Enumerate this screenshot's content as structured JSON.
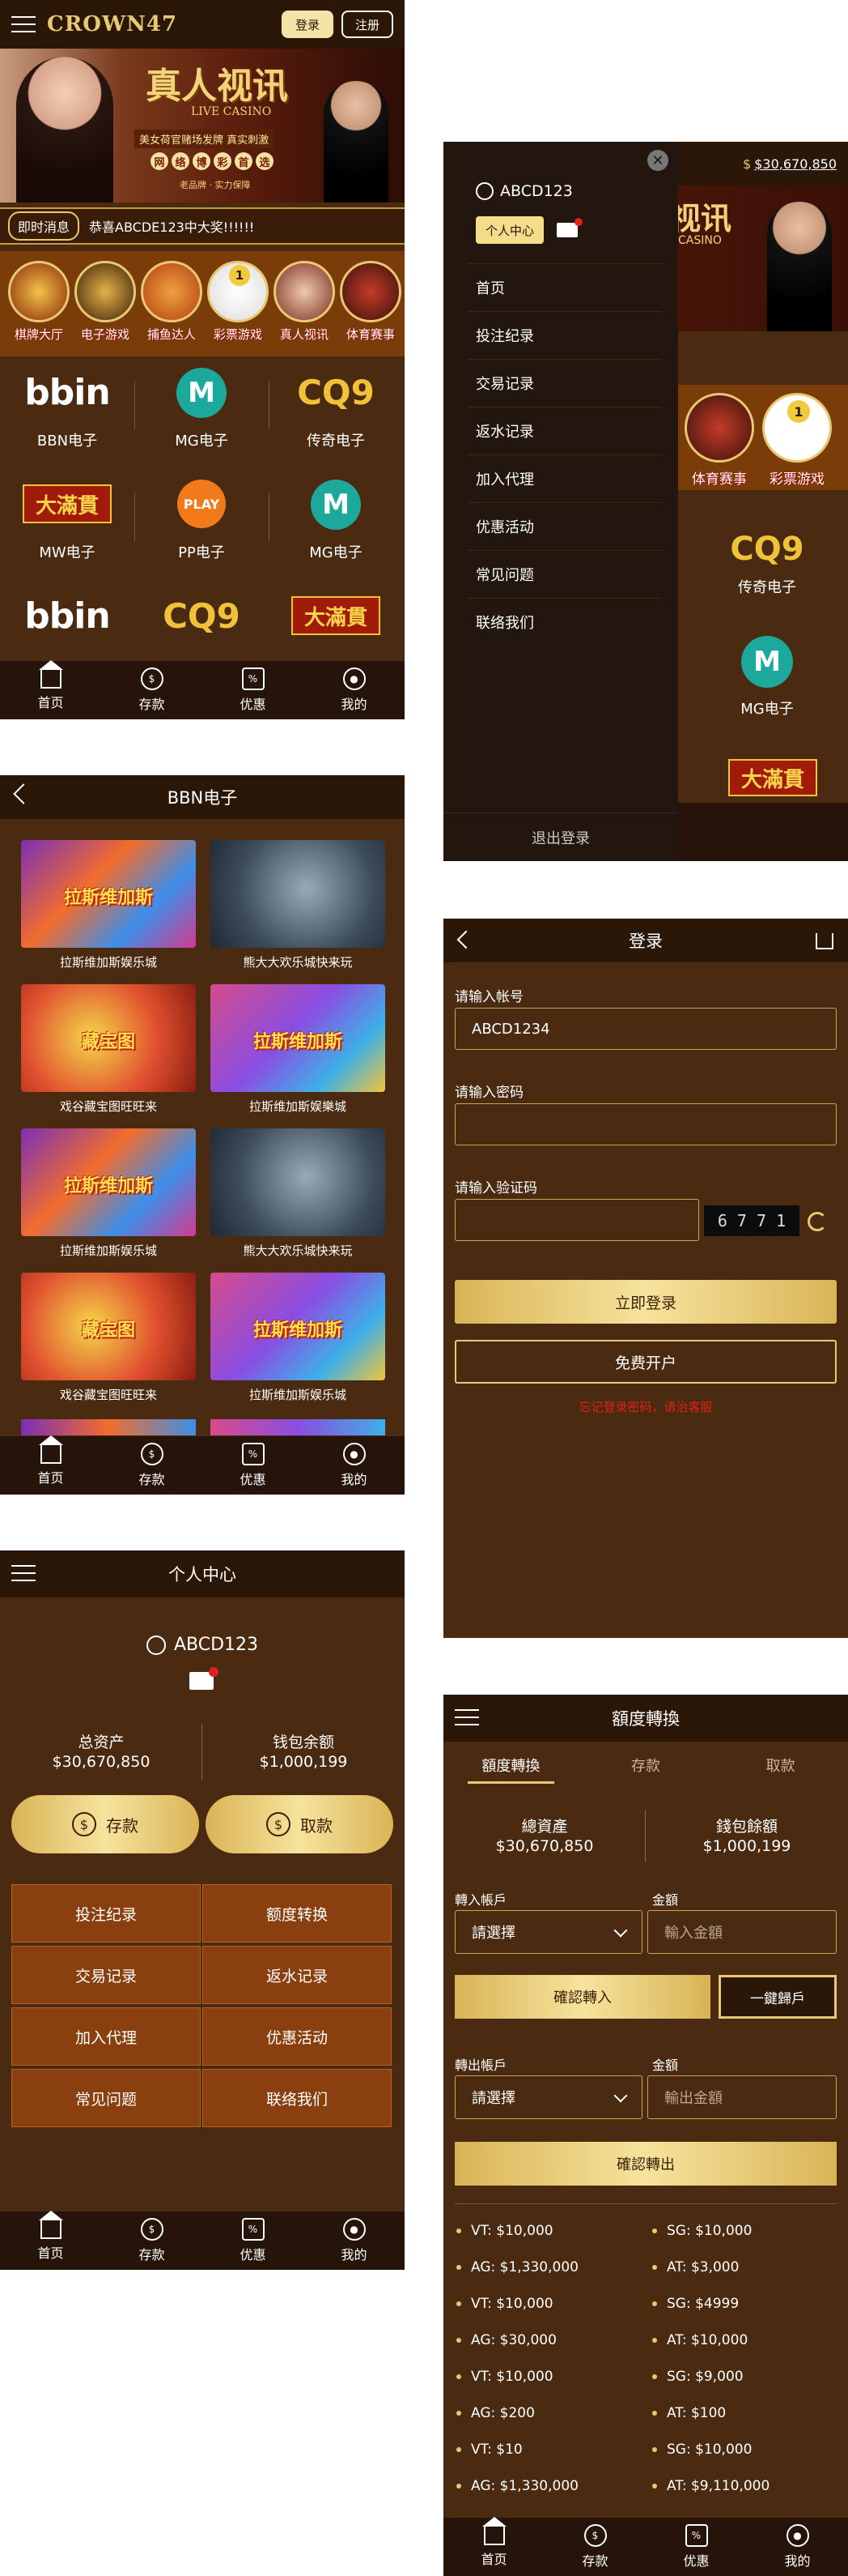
{
  "s1": {
    "logo": "CROWN47",
    "login": "登录",
    "register": "注册",
    "banner": {
      "title": "真人视讯",
      "sub": "LIVE CASINO",
      "line1": "美女荷官赌场发牌 真实刺激",
      "chips": [
        "网",
        "络",
        "博",
        "彩",
        "首",
        "选"
      ],
      "slogan": "老品牌 · 实力保障"
    },
    "marquee_label": "即时消息",
    "marquee_text": "恭喜ABCDE123中大奖!!!!!!",
    "cats": [
      "棋牌大厅",
      "电子游戏",
      "捕鱼达人",
      "彩票游戏",
      "真人视讯",
      "体育赛事"
    ],
    "lottery_badge": "1",
    "games": [
      {
        "logo": "bbin",
        "label": "BBN电子"
      },
      {
        "logo": "M",
        "label": "MG电子"
      },
      {
        "logo": "CQ9",
        "label": "传奇电子"
      },
      {
        "logo": "大滿貫",
        "label": "MW电子"
      },
      {
        "logo": "PLAY",
        "label": "PP电子"
      },
      {
        "logo": "M",
        "label": "MG电子"
      },
      {
        "logo": "bbin",
        "label": ""
      },
      {
        "logo": "CQ9",
        "label": ""
      },
      {
        "logo": "大滿貫",
        "label": ""
      }
    ]
  },
  "tabs": [
    "首页",
    "存款",
    "优惠",
    "我的"
  ],
  "s2": {
    "balance": "$30,670,850",
    "user": "ABCD123",
    "center_btn": "个人中心",
    "menu": [
      "首页",
      "投注纪录",
      "交易记录",
      "返水记录",
      "加入代理",
      "优惠活动",
      "常见问题",
      "联络我们"
    ],
    "logout": "退出登录",
    "bg_banner": "视讯",
    "bg_banner_sub": "CASINO",
    "bg_cats": [
      "体育赛事",
      "彩票游戏"
    ],
    "bg_lottery_badge": "1",
    "bg_games": [
      {
        "logo": "CQ9",
        "label": "传奇电子"
      },
      {
        "logo": "M",
        "label": "MG电子"
      },
      {
        "logo": "大滿貫",
        "label": ""
      }
    ]
  },
  "s3": {
    "title": "BBN电子",
    "items": [
      {
        "cap": "拉斯维加斯娱乐城",
        "img": "t1",
        "text": "拉斯维加斯"
      },
      {
        "cap": "熊大大欢乐城快来玩",
        "img": "t2",
        "text": ""
      },
      {
        "cap": "戏谷藏宝图旺旺来",
        "img": "t3",
        "text": "藏宝图"
      },
      {
        "cap": "拉斯维加斯娱樂城",
        "img": "t4",
        "text": "拉斯维加斯"
      },
      {
        "cap": "拉斯维加斯娱乐城",
        "img": "t1",
        "text": "拉斯维加斯"
      },
      {
        "cap": "熊大大欢乐城快来玩",
        "img": "t2",
        "text": ""
      },
      {
        "cap": "戏谷藏宝图旺旺来",
        "img": "t3",
        "text": "藏宝图"
      },
      {
        "cap": "拉斯维加斯娱乐城",
        "img": "t4",
        "text": "拉斯维加斯"
      }
    ]
  },
  "s4": {
    "title": "登录",
    "acc_label": "请输入帐号",
    "acc_value": "ABCD1234",
    "pwd_label": "请输入密码",
    "code_label": "请输入验证码",
    "captcha": "6 7 7 1",
    "login_btn": "立即登录",
    "register_btn": "免费开户",
    "forgot": "忘记登录密码，请治客服"
  },
  "s5": {
    "title": "个人中心",
    "user": "ABCD123",
    "total_label": "总资产",
    "total": "$30,670,850",
    "wallet_label": "钱包余额",
    "wallet": "$1,000,199",
    "deposit": "存款",
    "withdraw": "取款",
    "menu": [
      "投注纪录",
      "额度转换",
      "交易记录",
      "返水记录",
      "加入代理",
      "优惠活动",
      "常见问题",
      "联络我们"
    ]
  },
  "s6": {
    "title": "額度轉換",
    "tabs": [
      "額度轉換",
      "存款",
      "取款"
    ],
    "total_label": "總資產",
    "total": "$30,670,850",
    "wallet_label": "錢包餘額",
    "wallet": "$1,000,199",
    "in_acc_label": "轉入帳戶",
    "in_amt_label": "金額",
    "select": "請選擇",
    "in_ph": "輸入金額",
    "confirm_in": "確認轉入",
    "one_click": "一鍵歸戶",
    "out_acc_label": "轉出帳戶",
    "out_amt_label": "金額",
    "out_ph": "輸出金額",
    "confirm_out": "確認轉出",
    "platforms": [
      [
        "VT: $10,000",
        "SG: $10,000"
      ],
      [
        "AG: $1,330,000",
        "AT: $3,000"
      ],
      [
        "VT: $10,000",
        "SG: $4999"
      ],
      [
        "AG: $30,000",
        "AT: $10,000"
      ],
      [
        "VT: $10,000",
        "SG: $9,000"
      ],
      [
        "AG: $200",
        "AT: $100"
      ],
      [
        "VT: $10",
        "SG: $10,000"
      ],
      [
        "AG: $1,330,000",
        "AT: $9,110,000"
      ]
    ]
  }
}
